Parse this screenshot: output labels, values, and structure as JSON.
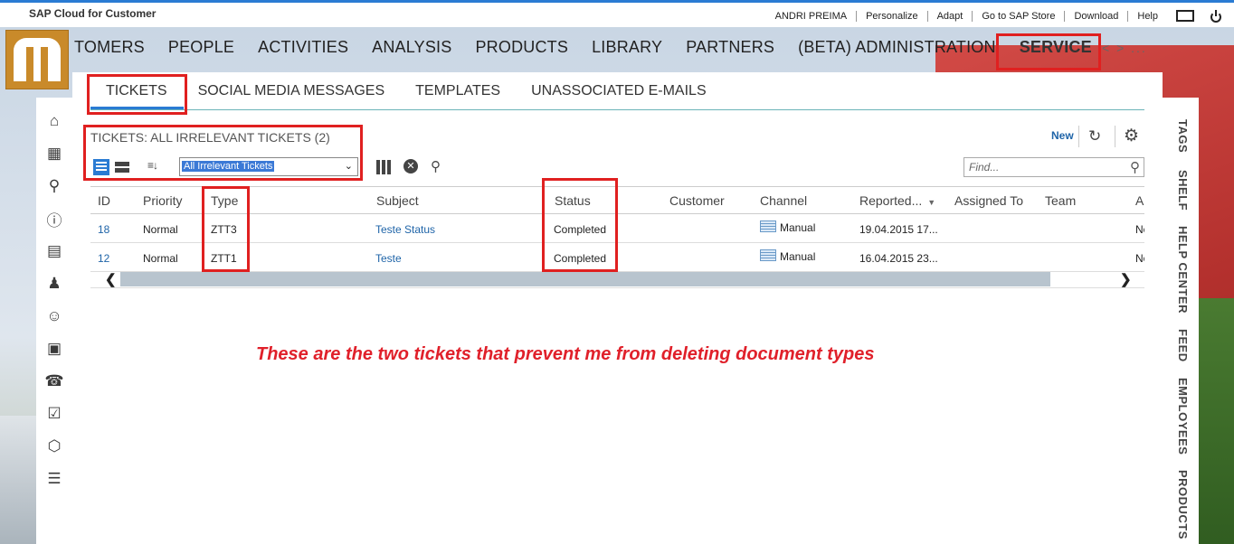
{
  "app": {
    "brand": "SAP Cloud for Customer",
    "top_links": [
      "ANDRI PREIMA",
      "Personalize",
      "Adapt",
      "Go to SAP Store",
      "Download",
      "Help"
    ]
  },
  "main_nav": {
    "items": [
      "TOMERS",
      "PEOPLE",
      "ACTIVITIES",
      "ANALYSIS",
      "PRODUCTS",
      "LIBRARY",
      "PARTNERS",
      "(BETA) ADMINISTRATION"
    ],
    "service": "SERVICE",
    "more": "< > ..."
  },
  "sub_nav": {
    "tabs": [
      "TICKETS",
      "SOCIAL MEDIA MESSAGES",
      "TEMPLATES",
      "UNASSOCIATED E-MAILS"
    ]
  },
  "list": {
    "title": "TICKETS: ALL IRRELEVANT TICKETS (2)",
    "new_label": "New",
    "query_value": "All Irrelevant Tickets",
    "find_placeholder": "Find..."
  },
  "table": {
    "headers": [
      "ID",
      "Priority",
      "Type",
      "Subject",
      "Status",
      "Customer",
      "Channel",
      "Reported...",
      "Assigned To",
      "Team",
      "Ap"
    ],
    "rows": [
      {
        "id": "18",
        "priority": "Normal",
        "type": "ZTT3",
        "subject": "Teste Status",
        "status": "Completed",
        "customer": "",
        "channel": "Manual",
        "reported": "19.04.2015 17...",
        "assigned": "",
        "team": "",
        "ap": "No"
      },
      {
        "id": "12",
        "priority": "Normal",
        "type": "ZTT1",
        "subject": "Teste",
        "status": "Completed",
        "customer": "",
        "channel": "Manual",
        "reported": "16.04.2015 23...",
        "assigned": "",
        "team": "",
        "ap": "No"
      }
    ]
  },
  "annotation": "These are the two tickets that prevent me from deleting document types",
  "right_bar": [
    "TAGS",
    "SHELF",
    "HELP CENTER",
    "FEED",
    "EMPLOYEES",
    "PRODUCTS"
  ],
  "colors": {
    "accent": "#2a7bd3",
    "highlight": "#e02020",
    "link": "#1f64a8"
  }
}
